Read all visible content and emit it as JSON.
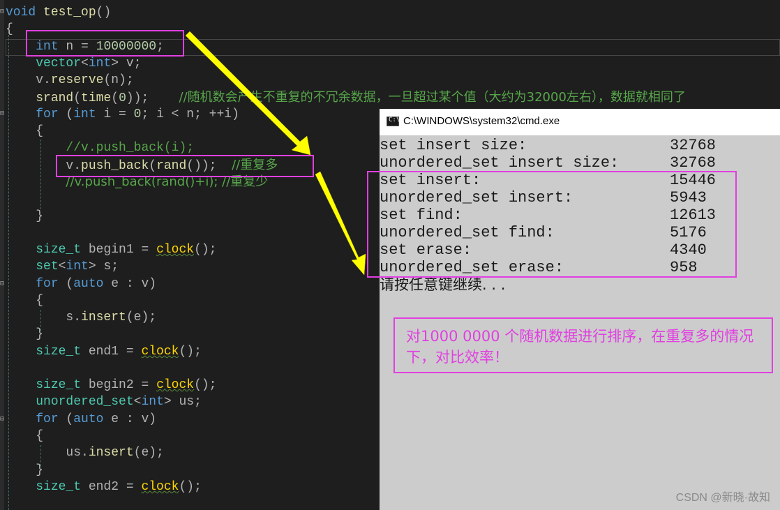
{
  "editor": {
    "lines": [
      [
        [
          "kw",
          "void"
        ],
        [
          "op",
          " "
        ],
        [
          "fn",
          "test_op"
        ],
        [
          "op",
          "()"
        ]
      ],
      [
        [
          "op",
          "{"
        ]
      ],
      [
        [
          "op",
          "    "
        ],
        [
          "kw",
          "int"
        ],
        [
          "op",
          " n = "
        ],
        [
          "num",
          "10000000"
        ],
        [
          "op",
          ";"
        ]
      ],
      [
        [
          "op",
          "    "
        ],
        [
          "ty",
          "vector"
        ],
        [
          "op",
          "<"
        ],
        [
          "kw",
          "int"
        ],
        [
          "op",
          "> v;"
        ]
      ],
      [
        [
          "op",
          "    v."
        ],
        [
          "fn",
          "reserve"
        ],
        [
          "op",
          "(n);"
        ]
      ],
      [
        [
          "op",
          "    "
        ],
        [
          "fn",
          "srand"
        ],
        [
          "op",
          "("
        ],
        [
          "fn",
          "time"
        ],
        [
          "op",
          "("
        ],
        [
          "num",
          "0"
        ],
        [
          "op",
          "));    "
        ],
        [
          "com",
          "//随机数会产生不重复的不冗余数据，一旦超过某个值（大约为32000左右），数据就相同了"
        ]
      ],
      [
        [
          "op",
          "    "
        ],
        [
          "kw",
          "for"
        ],
        [
          "op",
          " ("
        ],
        [
          "kw",
          "int"
        ],
        [
          "op",
          " i = "
        ],
        [
          "num",
          "0"
        ],
        [
          "op",
          "; i < n; ++i)"
        ]
      ],
      [
        [
          "op",
          "    {"
        ]
      ],
      [
        [
          "op",
          "        "
        ],
        [
          "com",
          "//v.push_back(i);"
        ]
      ],
      [
        [
          "op",
          "        v."
        ],
        [
          "fn",
          "push_back"
        ],
        [
          "op",
          "("
        ],
        [
          "fn",
          "rand"
        ],
        [
          "op",
          "());  "
        ],
        [
          "com",
          "//重复多"
        ]
      ],
      [
        [
          "op",
          "        "
        ],
        [
          "com",
          "//v.push_back(rand()+i); //重复少"
        ]
      ],
      [
        [
          "op",
          ""
        ]
      ],
      [
        [
          "op",
          "    }"
        ]
      ],
      [
        [
          "op",
          ""
        ]
      ],
      [
        [
          "op",
          "    "
        ],
        [
          "ty",
          "size_t"
        ],
        [
          "op",
          " begin1 = "
        ],
        [
          "fnb",
          "clock"
        ],
        [
          "op",
          "();"
        ]
      ],
      [
        [
          "op",
          "    "
        ],
        [
          "ty",
          "set"
        ],
        [
          "op",
          "<"
        ],
        [
          "kw",
          "int"
        ],
        [
          "op",
          "> s;"
        ]
      ],
      [
        [
          "op",
          "    "
        ],
        [
          "kw",
          "for"
        ],
        [
          "op",
          " ("
        ],
        [
          "kw",
          "auto"
        ],
        [
          "op",
          " e : v)"
        ]
      ],
      [
        [
          "op",
          "    {"
        ]
      ],
      [
        [
          "op",
          "        s."
        ],
        [
          "fn",
          "insert"
        ],
        [
          "op",
          "(e);"
        ]
      ],
      [
        [
          "op",
          "    }"
        ]
      ],
      [
        [
          "op",
          "    "
        ],
        [
          "ty",
          "size_t"
        ],
        [
          "op",
          " end1 = "
        ],
        [
          "fnb",
          "clock"
        ],
        [
          "op",
          "();"
        ]
      ],
      [
        [
          "op",
          ""
        ]
      ],
      [
        [
          "op",
          "    "
        ],
        [
          "ty",
          "size_t"
        ],
        [
          "op",
          " begin2 = "
        ],
        [
          "fnb",
          "clock"
        ],
        [
          "op",
          "();"
        ]
      ],
      [
        [
          "op",
          "    "
        ],
        [
          "ty",
          "unordered_set"
        ],
        [
          "op",
          "<"
        ],
        [
          "kw",
          "int"
        ],
        [
          "op",
          "> us;"
        ]
      ],
      [
        [
          "op",
          "    "
        ],
        [
          "kw",
          "for"
        ],
        [
          "op",
          " ("
        ],
        [
          "kw",
          "auto"
        ],
        [
          "op",
          " e : v)"
        ]
      ],
      [
        [
          "op",
          "    {"
        ]
      ],
      [
        [
          "op",
          "        us."
        ],
        [
          "fn",
          "insert"
        ],
        [
          "op",
          "(e);"
        ]
      ],
      [
        [
          "op",
          "    }"
        ]
      ],
      [
        [
          "op",
          "    "
        ],
        [
          "ty",
          "size_t"
        ],
        [
          "op",
          " end2 = "
        ],
        [
          "fnb",
          "clock"
        ],
        [
          "op",
          "();"
        ]
      ]
    ]
  },
  "console": {
    "title": "C:\\WINDOWS\\system32\\cmd.exe",
    "icon": "cmd-icon",
    "rows": [
      {
        "label": "set insert size:",
        "value": "32768"
      },
      {
        "label": "unordered_set insert size:",
        "value": "32768"
      },
      {
        "label": "set insert:",
        "value": "15446"
      },
      {
        "label": "unordered_set insert:",
        "value": "5943"
      },
      {
        "label": "set find:",
        "value": "12613"
      },
      {
        "label": "unordered_set find:",
        "value": "5176"
      },
      {
        "label": "set erase:",
        "value": "4340"
      },
      {
        "label": "unordered_set erase:",
        "value": "958"
      }
    ],
    "prompt": "请按任意键继续. . ."
  },
  "annotation": {
    "text": "对1000 0000 个随机数据进行排序，在重复多的情况下，对比效率！",
    "color": "#e040e0",
    "arrow_color": "#ffff00"
  },
  "watermark": "CSDN @新晓·故知"
}
